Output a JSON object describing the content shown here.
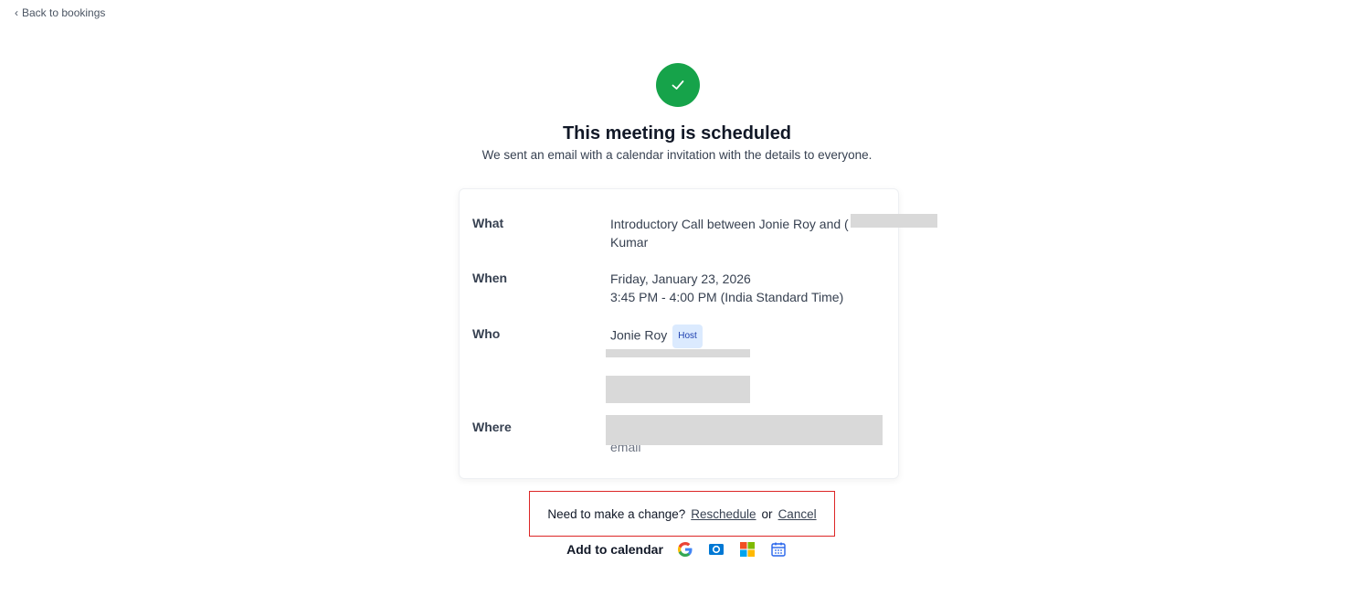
{
  "nav": {
    "back_label": "Back to bookings"
  },
  "header": {
    "title": "This meeting is scheduled",
    "subtitle": "We sent an email with a calendar invitation with the details to everyone."
  },
  "details": {
    "what_label": "What",
    "what_line1": "Introductory Call between Jonie Roy and (",
    "what_line2": "Kumar",
    "when_label": "When",
    "when_line1": "Friday, January 23, 2026",
    "when_line2": "3:45 PM - 4:00 PM (India Standard Time)",
    "who_label": "Who",
    "who_host_name": "Jonie Roy",
    "host_badge": "Host",
    "where_label": "Where",
    "where_partial": "email"
  },
  "change": {
    "prompt": "Need to make a change?",
    "reschedule": "Reschedule",
    "or": "or",
    "cancel": "Cancel"
  },
  "calendar": {
    "label": "Add to calendar",
    "icons": [
      "google-calendar-icon",
      "outlook-icon",
      "microsoft-office-icon",
      "ics-calendar-icon"
    ]
  },
  "colors": {
    "success": "#16a34a",
    "highlight_border": "#dc2626",
    "badge_bg": "#dbeafe",
    "badge_text": "#1e40af"
  }
}
